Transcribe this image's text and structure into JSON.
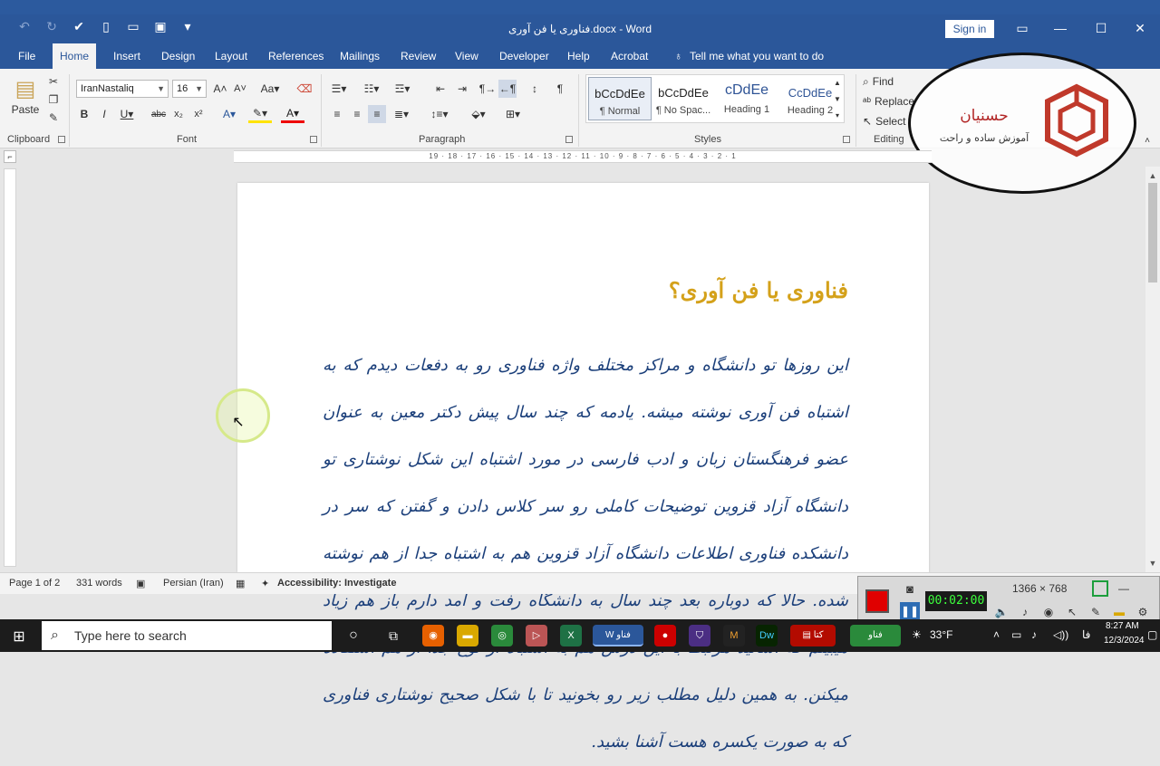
{
  "titlebar": {
    "doc_title": "فناوری یا فن آوری.docx - Word",
    "sign_in": "Sign in",
    "colors": {
      "bar": "#2b579a"
    }
  },
  "tabs": [
    {
      "label": "File"
    },
    {
      "label": "Home",
      "active": true
    },
    {
      "label": "Insert"
    },
    {
      "label": "Design"
    },
    {
      "label": "Layout"
    },
    {
      "label": "References"
    },
    {
      "label": "Mailings"
    },
    {
      "label": "Review"
    },
    {
      "label": "View"
    },
    {
      "label": "Developer"
    },
    {
      "label": "Help"
    },
    {
      "label": "Acrobat"
    }
  ],
  "tell_me": "Tell me what you want to do",
  "ribbon": {
    "clipboard": {
      "label": "Clipboard",
      "paste": "Paste"
    },
    "font": {
      "label": "Font",
      "family": "IranNastaliq",
      "size": "16"
    },
    "paragraph": {
      "label": "Paragraph"
    },
    "styles": {
      "label": "Styles",
      "items": [
        {
          "sample": "bCcDdEe",
          "name": "¶ Normal"
        },
        {
          "sample": "bCcDdEe",
          "name": "¶ No Spac..."
        },
        {
          "sample": "cDdEe",
          "name": "Heading 1"
        },
        {
          "sample": "CcDdEe",
          "name": "Heading 2"
        }
      ]
    },
    "editing": {
      "label": "Editing",
      "find": "Find",
      "replace": "Replace",
      "select": "Select"
    }
  },
  "logo": {
    "title": "حسنیان",
    "subtitle": "آموزش ساده و راحت"
  },
  "ruler_numbers": "19 · 18 · 17 · 16 · 15 · 14 · 13 · 12 · 11 · 10 · 9 · 8 · 7 · 6 · 5 · 4 · 3 · 2 · 1",
  "document": {
    "heading": "فناوری یا فن آوری؟",
    "body": "این روزها تو دانشگاه و مراکز مختلف واژه فناوری رو به دفعات دیدم که به اشتباه فن آوری نوشته میشه. یادمه که چند سال پیش دکتر معین به عنوان عضو فرهنگستان زبان و ادب فارسی در مورد اشتباه این شکل نوشتاری تو دانشگاه آزاد قزوین توضیحات کاملی رو سر کلاس دادن و گفتن که سر در دانشکده فناوری اطلاعات دانشگاه آزاد قزوین هم به اشتباه جدا از هم نوشته شده. حالا که دوباره بعد چند سال به دانشگاه رفت و آمد دارم باز هم زیاد میبینم که اساتید مرتبط با این درس هم به اشتباه از نوع جدا از هم استفاده میکنن. به همین دلیل مطلب زیر رو بخونید تا با شکل صحیح نوشتاری فناوری که به صورت یکسره هست آشنا بشید."
  },
  "statusbar": {
    "page": "Page 1 of 2",
    "words": "331 words",
    "language": "Persian (Iran)",
    "accessibility": "Accessibility: Investigate"
  },
  "recorder": {
    "time": "00:02:00",
    "resolution": "1366 × 768"
  },
  "taskbar": {
    "search_placeholder": "Type here to search",
    "weather": "33°F",
    "time": "8:27 AM",
    "date": "12/3/2024",
    "lang": "فا"
  }
}
